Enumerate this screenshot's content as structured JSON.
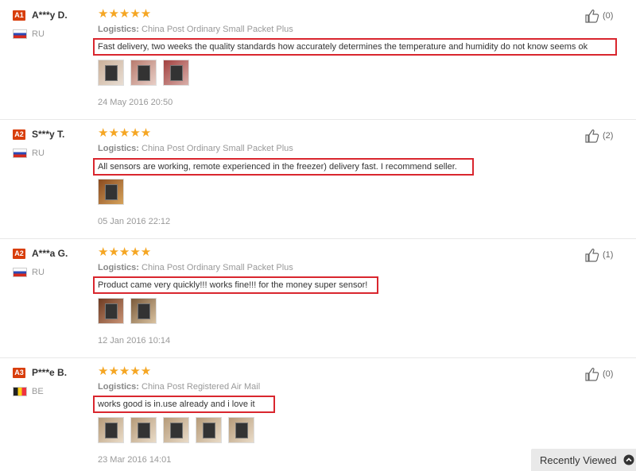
{
  "reviews": [
    {
      "level": "A1",
      "name": "A***y D.",
      "country": "RU",
      "stars": "★★★★★",
      "logistics_label": "Logistics:",
      "logistics": "China Post Ordinary Small Packet Plus",
      "feedback": "Fast delivery, two weeks the quality standards how accurately determines the temperature and humidity do not know seems ok",
      "date": "24 May 2016 20:50",
      "helpful": "(0)"
    },
    {
      "level": "A2",
      "name": "S***y T.",
      "country": "RU",
      "stars": "★★★★★",
      "logistics_label": "Logistics:",
      "logistics": "China Post Ordinary Small Packet Plus",
      "feedback": "All sensors are working, remote experienced in the freezer) delivery fast. I recommend seller.",
      "date": "05 Jan 2016 22:12",
      "helpful": "(2)"
    },
    {
      "level": "A2",
      "name": "A***a G.",
      "country": "RU",
      "stars": "★★★★★",
      "logistics_label": "Logistics:",
      "logistics": "China Post Ordinary Small Packet Plus",
      "feedback": "Product came very quickly!!! works fine!!! for the money super sensor!",
      "date": "12 Jan 2016 10:14",
      "helpful": "(1)"
    },
    {
      "level": "A3",
      "name": "P***e B.",
      "country": "BE",
      "stars": "★★★★★",
      "logistics_label": "Logistics:",
      "logistics": "China Post Registered Air Mail",
      "feedback": "works good is in.use already and i love it",
      "date": "23 Mar 2016 14:01",
      "helpful": "(0)"
    }
  ],
  "recently_viewed": "Recently Viewed",
  "colors": {
    "badge": "#d83e0c",
    "stars": "#f5a623",
    "highlight_border": "#d9262e"
  },
  "icons": {
    "thumbs_up": "thumbs-up-icon",
    "chevron_up": "chevron-up-icon"
  }
}
